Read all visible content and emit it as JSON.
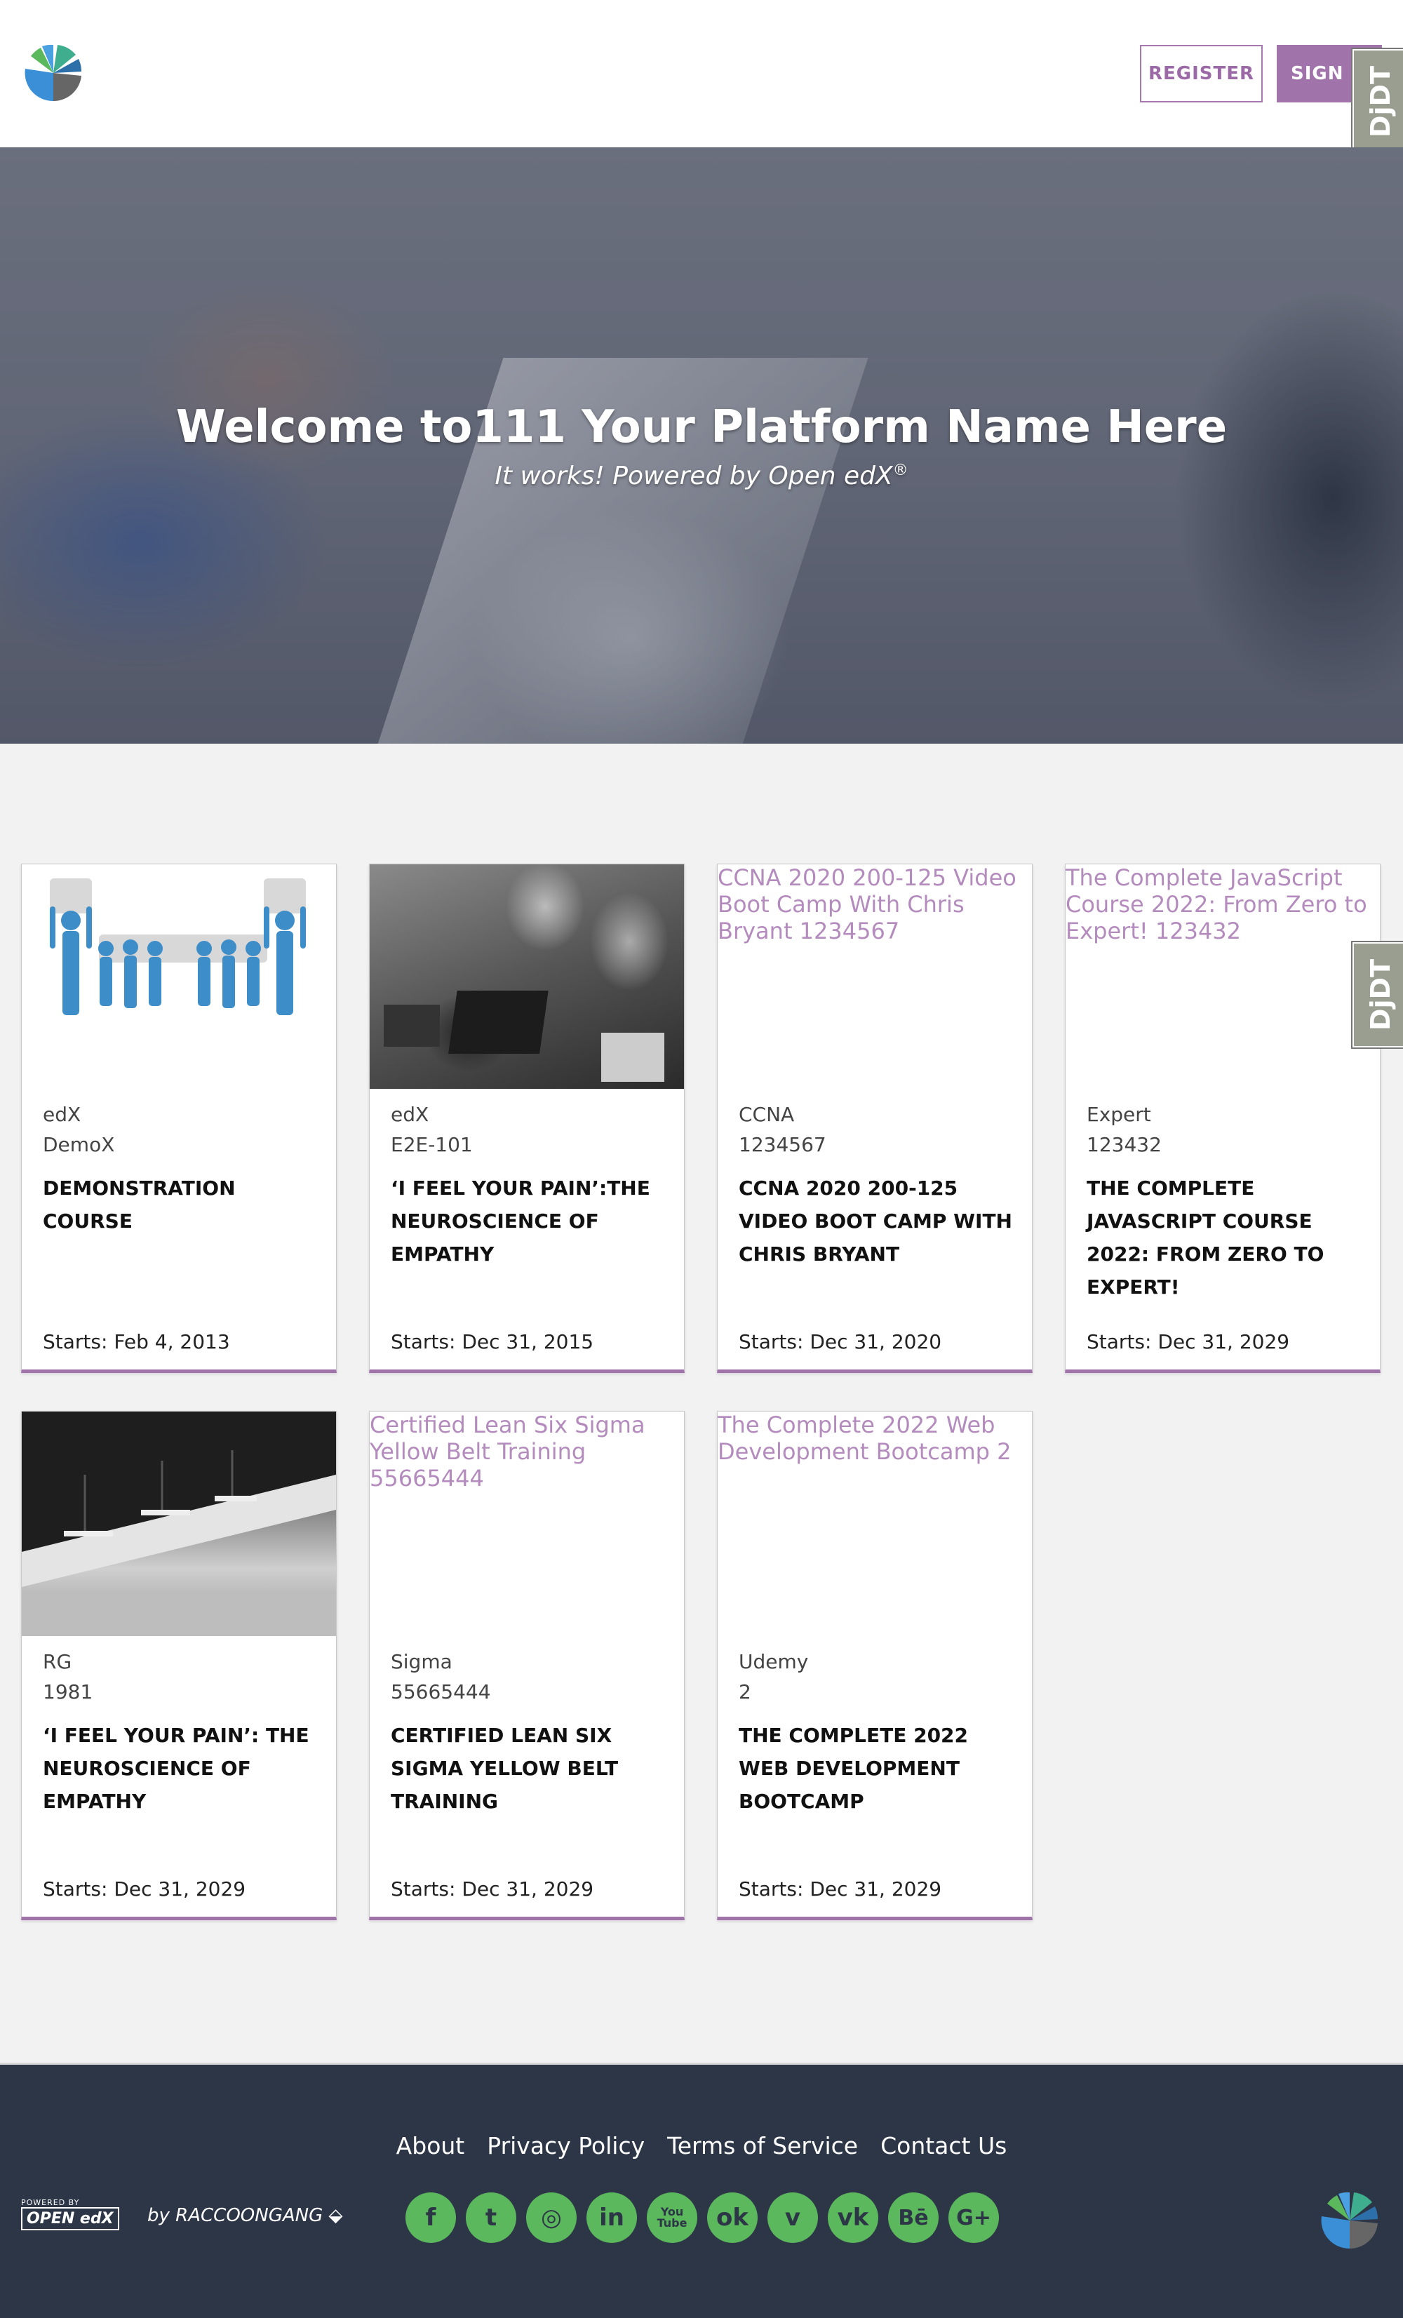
{
  "header": {
    "register_label": "REGISTER",
    "signin_label": "SIGN IN",
    "djdt_label": "DjDT"
  },
  "hero": {
    "title": "Welcome to111 Your Platform Name Here",
    "subtitle": "It works! Powered by Open edX",
    "subtitle_mark": "®"
  },
  "courses": [
    {
      "org": "edX",
      "number": "DemoX",
      "title": "Demonstration Course",
      "start": "Starts: Feb 4, 2013",
      "image_alt": ""
    },
    {
      "org": "edX",
      "number": "E2E-101",
      "title": "‘I Feel Your Pain’:The Neuroscience of Empathy",
      "start": "Starts: Dec 31, 2015",
      "image_alt": ""
    },
    {
      "org": "CCNA",
      "number": "1234567",
      "title": "CCNA 2020 200-125 Video Boot Camp With Chris Bryant",
      "start": "Starts: Dec 31, 2020",
      "image_alt": "CCNA 2020 200-125 Video Boot Camp With Chris Bryant 1234567"
    },
    {
      "org": "Expert",
      "number": "123432",
      "title": "The Complete JavaScript Course 2022: From Zero to Expert!",
      "start": "Starts: Dec 31, 2029",
      "image_alt": "The Complete JavaScript Course 2022: From Zero to Expert! 123432"
    },
    {
      "org": "RG",
      "number": "1981",
      "title": "‘I Feel Your Pain’: The Neuroscience of Empathy",
      "start": "Starts: Dec 31, 2029",
      "image_alt": ""
    },
    {
      "org": "Sigma",
      "number": "55665444",
      "title": "Certified Lean Six Sigma Yellow Belt Training",
      "start": "Starts: Dec 31, 2029",
      "image_alt": "Certified Lean Six Sigma Yellow Belt Training 55665444"
    },
    {
      "org": "Udemy",
      "number": "2",
      "title": "The Complete 2022 Web Development Bootcamp",
      "start": "Starts: Dec 31, 2029",
      "image_alt": "The Complete 2022 Web Development Bootcamp 2"
    }
  ],
  "footer": {
    "links": [
      "About",
      "Privacy Policy",
      "Terms of Service",
      "Contact Us"
    ],
    "social_icons": [
      "facebook-icon",
      "twitter-icon",
      "instagram-icon",
      "linkedin-icon",
      "youtube-icon",
      "odnoklassniki-icon",
      "vimeo-icon",
      "vk-icon",
      "behance-icon",
      "google-plus-icon"
    ],
    "social_glyphs": [
      "f",
      "t",
      "◎",
      "in",
      "You Tube",
      "ok",
      "v",
      "vk",
      "Bē",
      "G+"
    ],
    "powered_small": "POWERED BY",
    "powered_logo": "OPEN edX",
    "byline": "by RACCOONGANG",
    "accent_color": "#a173ab",
    "social_color": "#5cb85c"
  }
}
